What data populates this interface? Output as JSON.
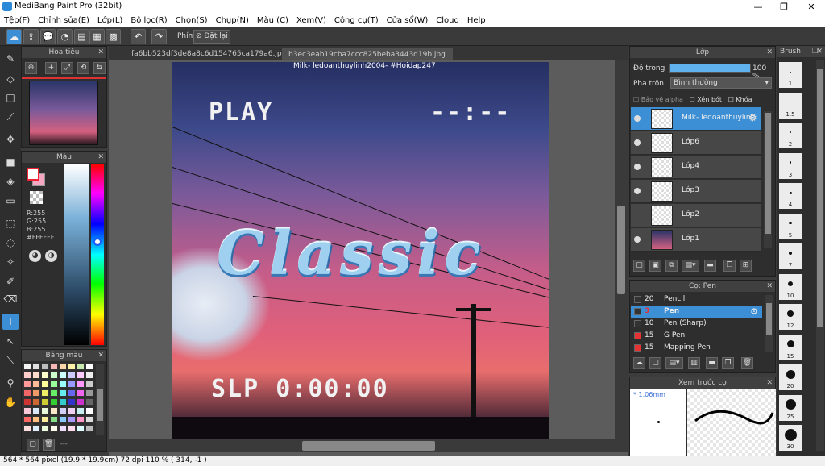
{
  "window": {
    "title": "MediBang Paint Pro (32bit)"
  },
  "menu": [
    "Tệp(F)",
    "Chỉnh sửa(E)",
    "Lớp(L)",
    "Bộ lọc(R)",
    "Chọn(S)",
    "Chụp(N)",
    "Màu (C)",
    "Xem(V)",
    "Công cụ(T)",
    "Cửa sổ(W)",
    "Cloud",
    "Help"
  ],
  "toolbar": {
    "hotkey_label": "Phím",
    "reset_label": "Đặt lại"
  },
  "tabs": [
    {
      "label": "fa6bb523df3de8a8c6d154765ca179a6.jpg"
    },
    {
      "label": "b3ec3eab19cba7ccc825beba3443d19b.jpg"
    }
  ],
  "navigator": {
    "title": "Hoa tiêu"
  },
  "color_panel": {
    "title": "Màu",
    "r": "R:255",
    "g": "G:255",
    "b": "B:255",
    "hex": "#FFFFFF"
  },
  "palette": {
    "title": "Bảng màu",
    "footer": "---"
  },
  "artwork": {
    "watermark": "Milk- ledoanthuylinh2004- #Hoidap247",
    "play": "PLAY",
    "timer": "--:--",
    "classic": "Classic",
    "slp": "SLP 0:00:00"
  },
  "layers": {
    "title": "Lớp",
    "opacity_label": "Độ trong",
    "opacity_value": "100 %",
    "opacity": 1.0,
    "blend_label": "Pha trộn",
    "blend_value": "Bình thường",
    "protect_alpha": "Bảo vệ alpha",
    "clip": "Xén bớt",
    "lock": "Khóa",
    "items": [
      {
        "name": "Milk- ledoanthuylinh",
        "selected": true
      },
      {
        "name": "Lớp6",
        "selected": false
      },
      {
        "name": "Lớp4",
        "selected": false
      },
      {
        "name": "Lớp3",
        "selected": false
      },
      {
        "name": "Lớp2",
        "selected": false
      },
      {
        "name": "Lớp1",
        "selected": false
      }
    ]
  },
  "brush_panel": {
    "title": "Cọ: Pen",
    "items": [
      {
        "size": "20",
        "name": "Pencil",
        "color": "#333333",
        "selected": false
      },
      {
        "size": "3",
        "name": "Pen",
        "color": "#333333",
        "selected": true
      },
      {
        "size": "10",
        "name": "Pen (Sharp)",
        "color": "#333333",
        "selected": false
      },
      {
        "size": "15",
        "name": "G Pen",
        "color": "#e63232",
        "selected": false
      },
      {
        "size": "15",
        "name": "Mapping Pen",
        "color": "#e63232",
        "selected": false
      }
    ]
  },
  "preview": {
    "title": "Xem trước cọ",
    "size": "* 1.06mm"
  },
  "brush_sizes": {
    "title": "Brush",
    "labels": [
      "1",
      "1.5",
      "2",
      "3",
      "4",
      "5",
      "7",
      "10",
      "12",
      "15",
      "20",
      "25",
      "30"
    ]
  },
  "status": {
    "text": "564 * 564 pixel   (19.9 * 19.9cm)   72 dpi   110 %   ( 314, -1 )"
  },
  "colors": {
    "accent": "#3d8fd5",
    "panel": "#2e2e2e"
  }
}
